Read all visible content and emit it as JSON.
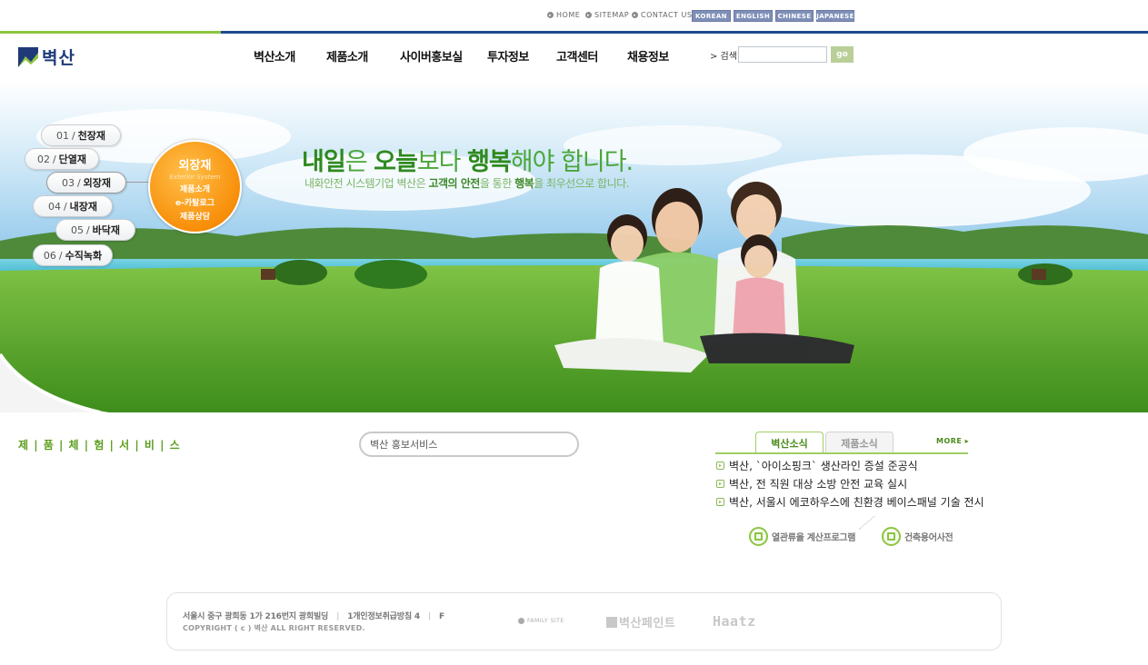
{
  "util": {
    "home": "HOME",
    "sitemap": "SITEMAP",
    "contact": "CONTACT US",
    "langs": [
      "KOREAN",
      "ENGLISH",
      "CHINESE",
      "JAPANESE"
    ]
  },
  "logo": {
    "text": "벽산"
  },
  "gnb": [
    "벽산소개",
    "제품소개",
    "사이버홍보실",
    "투자정보",
    "고객센터",
    "채용정보"
  ],
  "search": {
    "label": "> 검색",
    "go": "go"
  },
  "hero": {
    "menu": [
      {
        "num": "01",
        "label": "천장재"
      },
      {
        "num": "02",
        "label": "단열재"
      },
      {
        "num": "03",
        "label": "외장재"
      },
      {
        "num": "04",
        "label": "내장재"
      },
      {
        "num": "05",
        "label": "바닥재"
      },
      {
        "num": "06",
        "label": "수직녹화"
      }
    ],
    "circle": {
      "title": "외장재",
      "subtitle": "Exterior System",
      "links": [
        "제품소개",
        "e-카탈로그",
        "제품상담"
      ]
    },
    "headline": {
      "p1": "내일",
      "p2": "은 ",
      "p3": "오늘",
      "p4": "보다 ",
      "p5": "행복",
      "p6": "해야 합니다."
    },
    "subline": {
      "p1": "내화안전 시스템기업 벽산은 ",
      "p2": "고객의 안전",
      "p3": "을 통한 ",
      "p4": "행복",
      "p5": "을 최우선으로 합니다."
    }
  },
  "content": {
    "service_title": "제 | 품 | 체 | 험 | 서 | 비 | 스",
    "pr_service": "벽산 홍보서비스",
    "tabs": [
      "벽산소식",
      "제품소식"
    ],
    "more": "MORE ▸",
    "news": [
      "벽산, `아이소핑크` 생산라인 증설 준공식",
      "벽산, 전 직원 대상 소방 안전 교육 실시",
      "벽산, 서울시 에코하우스에 친환경 베이스패널 기술 전시"
    ],
    "tools": [
      "열관류율 계산프로그램",
      "건축용어사전"
    ]
  },
  "footer": {
    "address": "서울시 중구 광희동 1가 216번지 광희빌딩",
    "privacy": "1개인정보취급방침 4",
    "extra": "F",
    "copyright": "COPYRIGHT ( c )  벽산  ALL RIGHT RESERVED.",
    "family_site": "FAMILY SITE",
    "partners": [
      "벽산페인트",
      "Haatz"
    ]
  },
  "colors": {
    "brand_green": "#8cc540",
    "brand_blue": "#1e4a8f",
    "accent_orange": "#f88f0a",
    "lang_button": "#7f8fb8"
  }
}
